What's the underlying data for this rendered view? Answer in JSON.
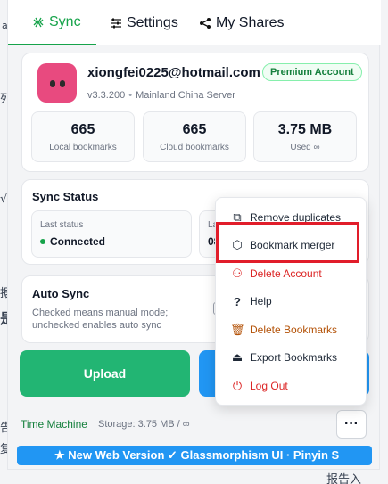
{
  "background": {
    "frag_top_left": "a",
    "frag_mid1": "列",
    "frag_mid2": "√",
    "frag_mid3": "据",
    "frag_mid4": "是",
    "frag_low1": "告",
    "frag_low2": "复",
    "frag_bottom": "报告入"
  },
  "tabs": [
    {
      "label": "Sync",
      "icon": "sync-icon",
      "active": true
    },
    {
      "label": "Settings",
      "icon": "sliders-icon"
    },
    {
      "label": "My Shares",
      "icon": "share-icon"
    }
  ],
  "account": {
    "email": "xiongfei0225@hotmail.com",
    "badge": "Premium Account",
    "version": "v3.3.200",
    "server": "Mainland China Server"
  },
  "stats": [
    {
      "value": "665",
      "label": "Local bookmarks"
    },
    {
      "value": "665",
      "label": "Cloud bookmarks"
    },
    {
      "value": "3.75 MB",
      "label": "Used ∞"
    }
  ],
  "sync_status": {
    "title": "Sync Status",
    "last_status_caption": "Last status",
    "last_status_value": "Connected",
    "second_caption": "La",
    "second_value": "08"
  },
  "auto_sync": {
    "title": "Auto Sync",
    "description": "Checked means manual mode; unchecked enables auto sync"
  },
  "buttons": {
    "upload": "Upload"
  },
  "footer": {
    "time_machine": "Time Machine",
    "storage": "Storage: 3.75 MB / ∞",
    "more": "···"
  },
  "banner": "★ New Web Version ✓ Glassmorphism UI · Pinyin S",
  "menu": {
    "items": [
      {
        "label": "Remove duplicates",
        "icon": "copy-icon"
      },
      {
        "label": "Bookmark merger",
        "icon": "cube-icon"
      },
      {
        "label": "Delete Account",
        "icon": "user-delete-icon"
      },
      {
        "label": "Help",
        "icon": "question-icon"
      },
      {
        "label": "Delete Bookmarks",
        "icon": "trash-icon"
      },
      {
        "label": "Export Bookmarks",
        "icon": "export-icon"
      },
      {
        "label": "Log Out",
        "icon": "power-icon"
      }
    ],
    "highlighted": "Bookmark merger"
  },
  "colors": {
    "accent": "#16a34a",
    "upload": "#22b573",
    "primary_blue": "#2196f3",
    "danger": "#dc2626",
    "warning": "#b45309",
    "highlight": "#e11d2a"
  }
}
